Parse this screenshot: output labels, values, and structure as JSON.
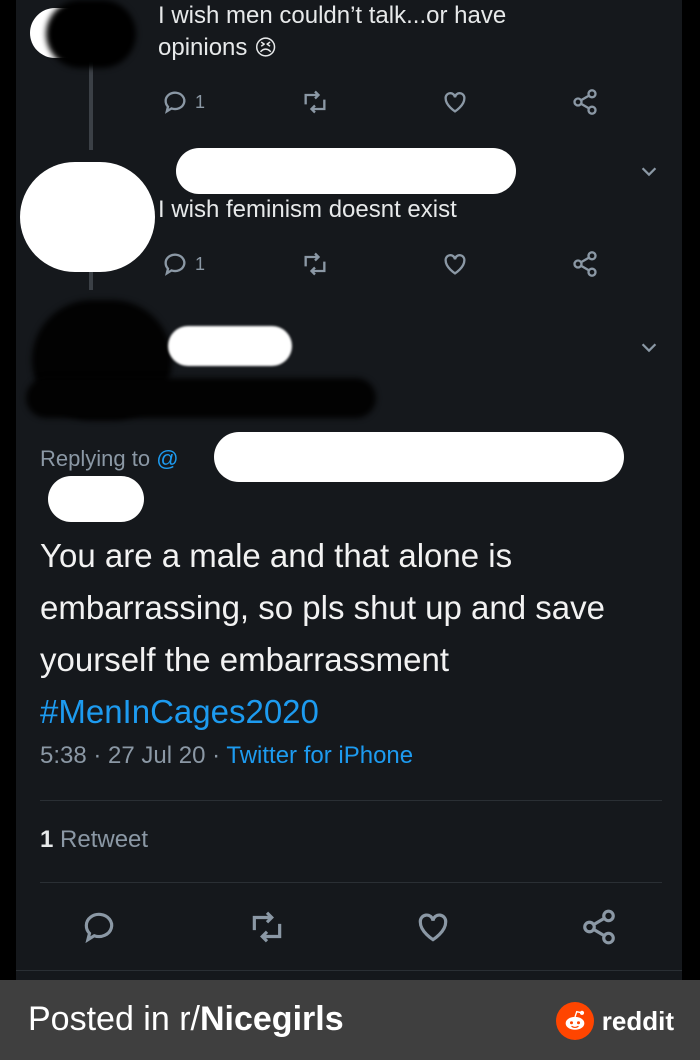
{
  "tweets": [
    {
      "text_line1": "I wish men couldn’t talk...or have",
      "text_line2": "opinions",
      "emoji": "😣",
      "reply_count": "1"
    },
    {
      "text": "I wish feminism doesnt exist",
      "reply_count": "1"
    }
  ],
  "main_tweet": {
    "replying_to_prefix": "Replying to",
    "handle_prefix": "@",
    "text": "You are a male and that alone is embarrassing, so pls shut up and save yourself the embarrassment",
    "hashtag": "#MenInCages2020",
    "time": "5:38",
    "date": "27 Jul 20",
    "source": "Twitter for iPhone",
    "retweet_count": "1",
    "retweet_label": "Retweet"
  },
  "footer": {
    "posted_prefix": "Posted in r/",
    "subreddit": "Nicegirls",
    "brand": "reddit"
  },
  "colors": {
    "background": "#15181c",
    "link": "#1d9bf0",
    "muted": "#8b98a5",
    "footer_bg": "#3f3f3f",
    "reddit_orange": "#ff4500"
  },
  "icons": [
    "reply-icon",
    "retweet-icon",
    "like-icon",
    "share-icon",
    "chevron-down-icon",
    "reddit-logo-icon"
  ]
}
